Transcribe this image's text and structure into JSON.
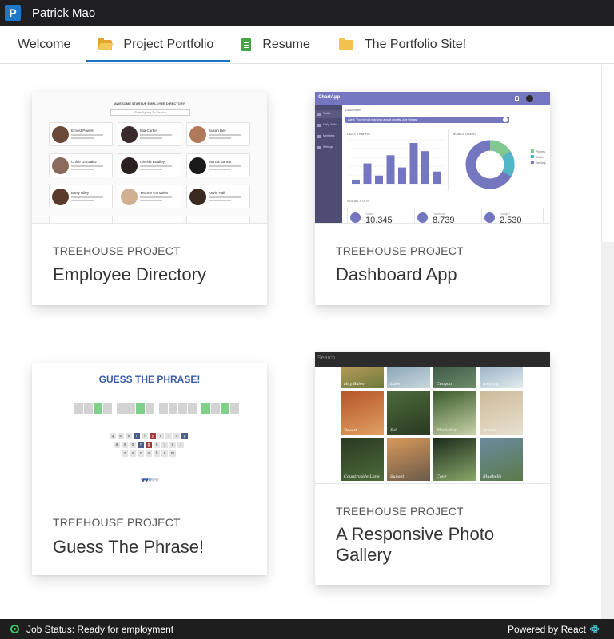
{
  "app": {
    "icon_letter": "P",
    "title": "Patrick Mao"
  },
  "tabs": [
    {
      "label": "Welcome",
      "icon": "none",
      "active": false
    },
    {
      "label": "Project Portfolio",
      "icon": "folder-open-icon",
      "active": true
    },
    {
      "label": "Resume",
      "icon": "document-icon",
      "active": false
    },
    {
      "label": "The Portfolio Site!",
      "icon": "folder-icon",
      "active": false
    }
  ],
  "projects": [
    {
      "category": "TREEHOUSE PROJECT",
      "name": "Employee Directory",
      "preview": {
        "heading": "AWESOME STARTUP EMPLOYEE DIRECTORY",
        "search_placeholder": "Start Typing To Search",
        "employees": [
          "Ernest Powell",
          "Mia Carter",
          "Susan Bell",
          "Chloe Gonzalez",
          "Glenda Bradley",
          "Marcia Barrett",
          "Barry Riley",
          "Yvonne Gonzales",
          "Kevin Hall"
        ]
      }
    },
    {
      "category": "TREEHOUSE PROJECT",
      "name": "Dashboard App",
      "preview": {
        "brand": "ChartApp",
        "search_placeholder": "Dashboard",
        "alert": "Alert: You're not working about charts. Are things",
        "nav": [
          "Traffic",
          "Daily Visits",
          "Members",
          "Settings"
        ],
        "traffic_title": "DAILY TRAFFIC",
        "mobile_title": "MOBILE USERS",
        "legend": [
          "Phones",
          "Tablets",
          "Desktop"
        ],
        "social_title": "SOCIAL STATS",
        "social": [
          {
            "network": "Twitter",
            "value": "10,345"
          },
          {
            "network": "Facebook",
            "value": "8,739"
          },
          {
            "network": "Google+",
            "value": "2,530"
          }
        ],
        "bar_values": [
          1,
          5,
          2,
          7,
          4,
          10,
          8,
          3
        ]
      }
    },
    {
      "category": "TREEHOUSE PROJECT",
      "name": "Guess The Phrase!",
      "preview": {
        "heading": "GUESS THE PHRASE!",
        "keyboard_rows": [
          [
            "q",
            "w",
            "e",
            "r",
            "t",
            "y",
            "u",
            "i",
            "o",
            "p"
          ],
          [
            "a",
            "s",
            "d",
            "f",
            "g",
            "h",
            "j",
            "k",
            "l"
          ],
          [
            "z",
            "x",
            "c",
            "v",
            "b",
            "n",
            "m"
          ]
        ],
        "hearts": "♥♥♥♥♥"
      }
    },
    {
      "category": "TREEHOUSE PROJECT",
      "name": "A Responsive Photo Gallery",
      "preview": {
        "search_placeholder": "Search",
        "captions": [
          "Hay Bales",
          "Lake",
          "Canyon",
          "Iceberg",
          "Desert",
          "Fall",
          "Plantation",
          "Dunes",
          "Countryside Lane",
          "Sunset",
          "Cave",
          "Bluebells"
        ]
      }
    }
  ],
  "status": {
    "text": "Job Status: Ready for employment",
    "powered": "Powered by React",
    "accent": "#3ac56a"
  },
  "colors": {
    "titlebar": "#1f1f22",
    "tab_accent": "#1b73c3",
    "dashboard_purple": "#7477bf",
    "dashboard_green": "#81c98f"
  }
}
